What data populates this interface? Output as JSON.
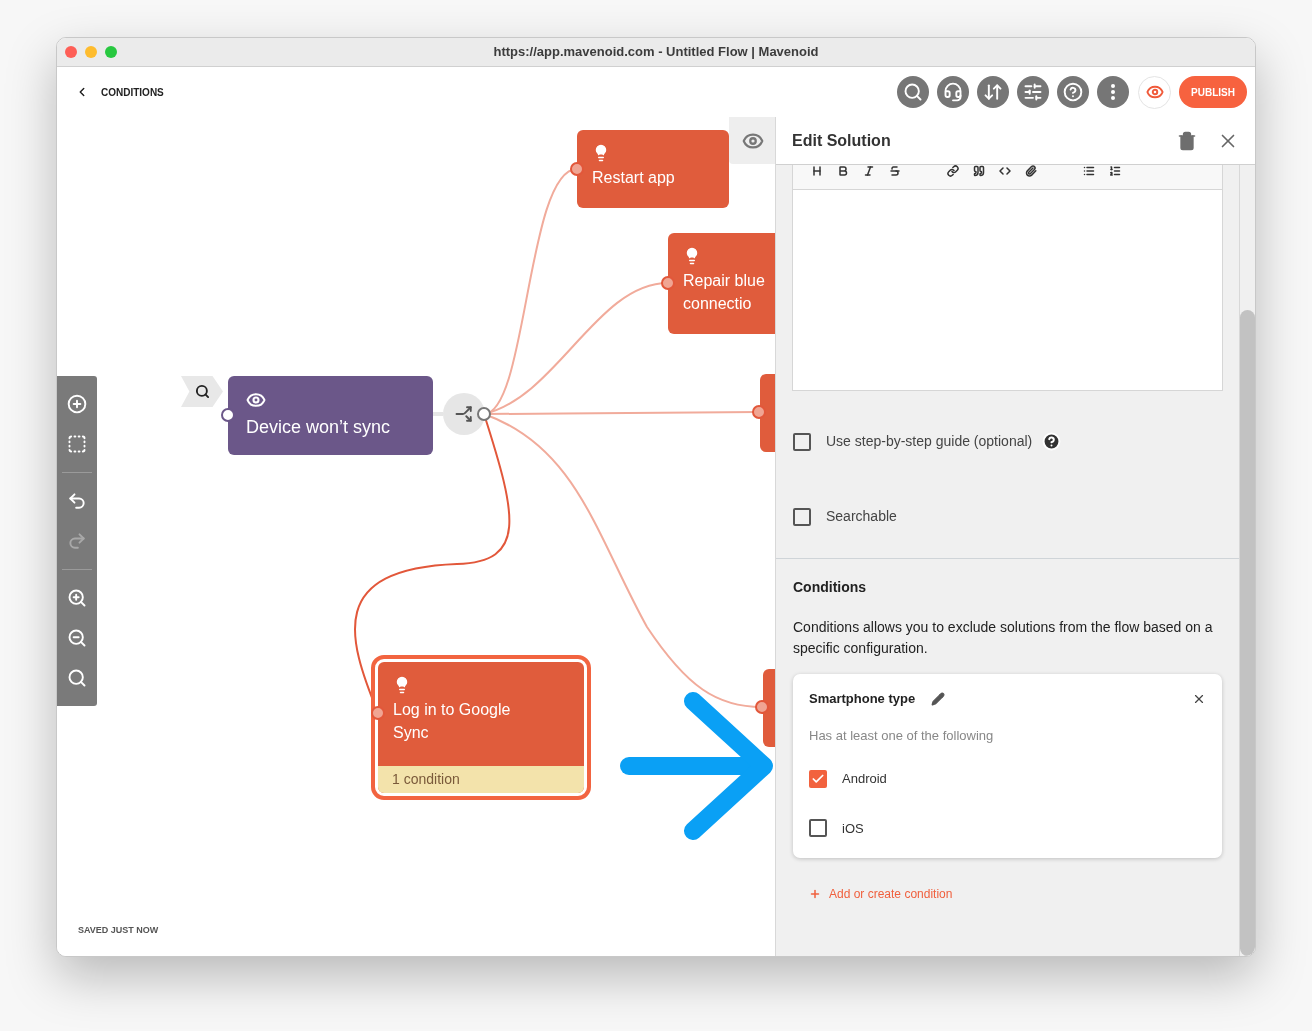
{
  "window": {
    "title": "https://app.mavenoid.com - Untitled Flow | Mavenoid"
  },
  "header": {
    "back_label": "CONDITIONS",
    "publish_label": "PUBLISH"
  },
  "canvas_tools": [
    {
      "disabled": false
    },
    {
      "disabled": false
    },
    {
      "disabled": false
    },
    {
      "disabled": true
    },
    {
      "disabled": false
    },
    {
      "disabled": false
    },
    {
      "disabled": false
    }
  ],
  "nodes": [
    {
      "kind": "question",
      "title": "Device won’t sync"
    },
    {
      "kind": "solution",
      "title": "Restart app",
      "selected": false
    },
    {
      "kind": "solution",
      "title": "Repair blue connectio",
      "selected": false
    },
    {
      "kind": "solution",
      "selected": false
    },
    {
      "kind": "solution",
      "title": "Log in to Google Sync",
      "condition_label": "1 condition",
      "selected": true
    },
    {
      "kind": "solution",
      "selected": false
    }
  ],
  "status": "SAVED JUST NOW",
  "panel": {
    "title": "Edit Solution",
    "options": [
      {
        "label": "Use step-by-step guide (optional)",
        "checked": false,
        "help": true
      },
      {
        "label": "Searchable",
        "checked": false,
        "help": false
      }
    ],
    "conditions": {
      "heading": "Conditions",
      "description": "Conditions allows you to exclude solutions from the flow based on a specific configuration.",
      "cards": [
        {
          "title": "Smartphone type",
          "subtitle": "Has at least one of the following",
          "options": [
            {
              "label": "Android",
              "checked": true
            },
            {
              "label": "iOS",
              "checked": false
            }
          ]
        }
      ],
      "add_label": "Add or create condition"
    }
  }
}
